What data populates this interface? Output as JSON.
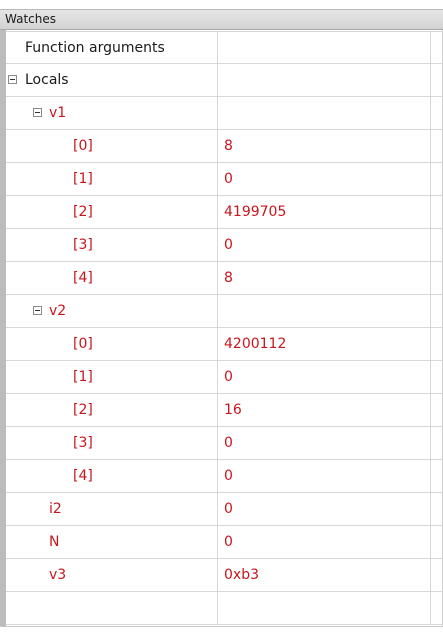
{
  "window": {
    "title": "Watches"
  },
  "rows": [
    {
      "name": "Function arguments",
      "value": "",
      "level": 0,
      "expander": false,
      "black": true
    },
    {
      "name": "Locals",
      "value": "",
      "level": 0,
      "expander": true,
      "black": true
    },
    {
      "name": "v1",
      "value": "",
      "level": 1,
      "expander": true,
      "black": false
    },
    {
      "name": "[0]",
      "value": "8",
      "level": 2,
      "expander": false,
      "black": false
    },
    {
      "name": "[1]",
      "value": "0",
      "level": 2,
      "expander": false,
      "black": false
    },
    {
      "name": "[2]",
      "value": "4199705",
      "level": 2,
      "expander": false,
      "black": false
    },
    {
      "name": "[3]",
      "value": "0",
      "level": 2,
      "expander": false,
      "black": false
    },
    {
      "name": "[4]",
      "value": "8",
      "level": 2,
      "expander": false,
      "black": false
    },
    {
      "name": "v2",
      "value": "",
      "level": 1,
      "expander": true,
      "black": false
    },
    {
      "name": "[0]",
      "value": "4200112",
      "level": 2,
      "expander": false,
      "black": false
    },
    {
      "name": "[1]",
      "value": "0",
      "level": 2,
      "expander": false,
      "black": false
    },
    {
      "name": "[2]",
      "value": "16",
      "level": 2,
      "expander": false,
      "black": false
    },
    {
      "name": "[3]",
      "value": "0",
      "level": 2,
      "expander": false,
      "black": false
    },
    {
      "name": "[4]",
      "value": "0",
      "level": 2,
      "expander": false,
      "black": false
    },
    {
      "name": "i2",
      "value": "0",
      "level": 1,
      "expander": false,
      "black": false
    },
    {
      "name": "N",
      "value": "0",
      "level": 1,
      "expander": false,
      "black": false
    },
    {
      "name": "v3",
      "value": "0xb3",
      "level": 1,
      "expander": false,
      "black": false
    },
    {
      "name": "",
      "value": "",
      "level": 0,
      "expander": false,
      "black": true
    }
  ],
  "colors": {
    "changed_value": "#c8161e",
    "normal_text": "#1a1a1a",
    "grid_line": "#d7d7d7"
  }
}
